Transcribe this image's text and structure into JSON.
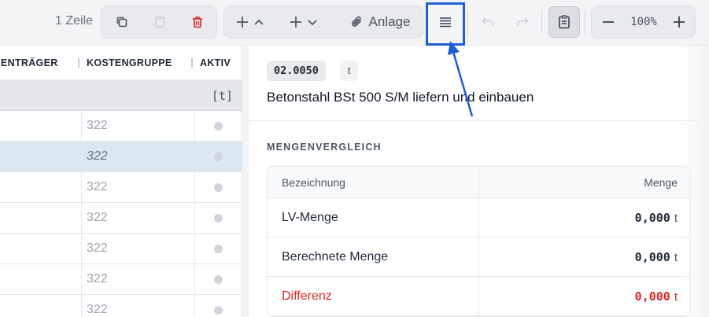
{
  "toolbar": {
    "rows_count": "1 Zeile",
    "anlage_label": "Anlage",
    "zoom": "100%"
  },
  "table": {
    "columns": [
      "ENTRÄGER",
      "KOSTENGRUPPE",
      "AKTIV"
    ],
    "unit": "[t]",
    "rows": [
      {
        "kostengruppe": "322",
        "selected": false
      },
      {
        "kostengruppe": "322",
        "selected": true
      },
      {
        "kostengruppe": "322",
        "selected": false
      },
      {
        "kostengruppe": "322",
        "selected": false
      },
      {
        "kostengruppe": "322",
        "selected": false
      },
      {
        "kostengruppe": "322",
        "selected": false
      },
      {
        "kostengruppe": "322",
        "selected": false
      }
    ]
  },
  "detail": {
    "code": "02.0050",
    "unit": "t",
    "description": "Betonstahl BSt 500 S/M liefern und einbauen",
    "section_title": "MENGENVERGLEICH",
    "table_headers": {
      "name": "Bezeichnung",
      "qty": "Menge"
    },
    "rows": [
      {
        "label": "LV-Menge",
        "value": "0,000",
        "unit": "t"
      },
      {
        "label": "Berechnete Menge",
        "value": "0,000",
        "unit": "t"
      },
      {
        "label": "Differenz",
        "value": "0,000",
        "unit": "t"
      }
    ]
  },
  "colors": {
    "highlight": "#1f5fd6",
    "delete": "#dc2626",
    "difference": "#dc2626",
    "selected_row": "#dbe7f3"
  }
}
